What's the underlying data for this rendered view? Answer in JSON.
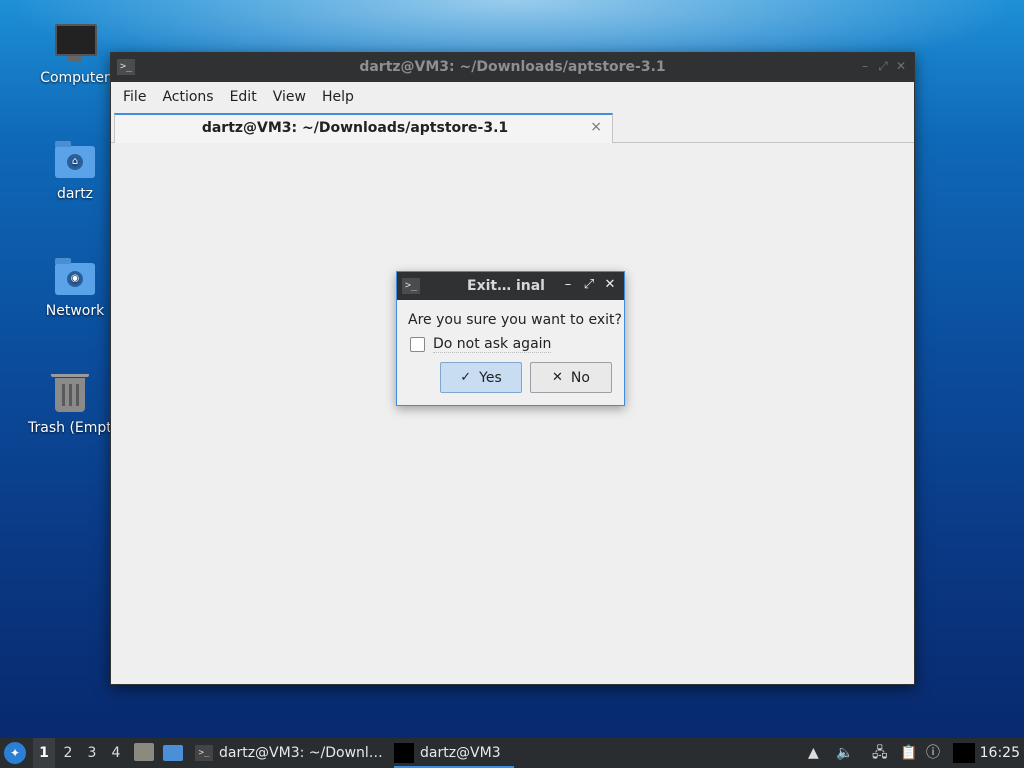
{
  "desktop": {
    "icons": [
      {
        "label": "Computer",
        "icon": "computer-icon"
      },
      {
        "label": "dartz",
        "icon": "home-folder-icon"
      },
      {
        "label": "Network",
        "icon": "network-folder-icon"
      },
      {
        "label": "Trash (Empty)",
        "label_visible": "Trash (Empt",
        "icon": "trash-icon"
      }
    ]
  },
  "window": {
    "title": "dartz@VM3: ~/Downloads/aptstore-3.1",
    "menu": [
      "File",
      "Actions",
      "Edit",
      "View",
      "Help"
    ],
    "tab": {
      "label": "dartz@VM3: ~/Downloads/aptstore-3.1",
      "close": "×"
    },
    "controls": {
      "minimize": "–",
      "maximize": "⤢",
      "close": "✕"
    }
  },
  "dialog": {
    "title": "Exit… inal",
    "message": "Are you sure you want to exit?",
    "checkbox_label": "Do not ask again",
    "yes_label": "Yes",
    "no_label": "No",
    "yes_icon": "✓",
    "no_icon": "✕",
    "controls": {
      "minimize": "–",
      "maximize": "⤢",
      "close": "✕"
    }
  },
  "taskbar": {
    "workspaces": [
      "1",
      "2",
      "3",
      "4"
    ],
    "active_workspace": "1",
    "tasks": [
      {
        "label": "dartz@VM3: ~/Downl…"
      },
      {
        "label": "dartz@VM3"
      }
    ],
    "clock": "16:25"
  },
  "colors": {
    "accent": "#3d8ee0",
    "titlebar": "#2f3133",
    "taskbar": "#2a2d30"
  }
}
